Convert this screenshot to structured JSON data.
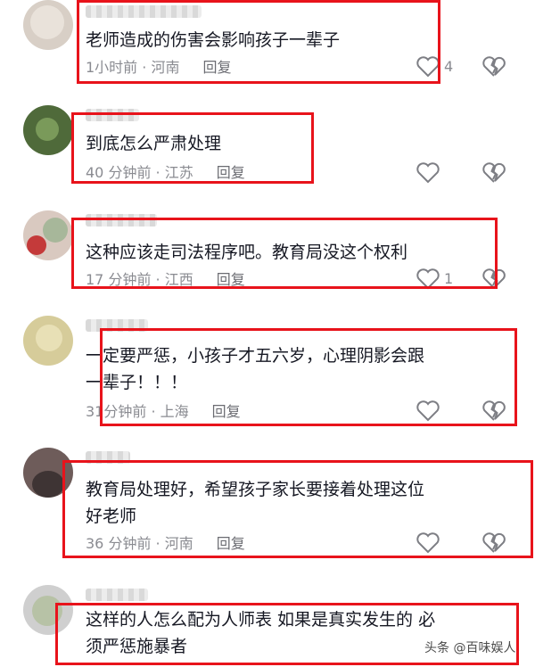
{
  "comments": [
    {
      "text": "老师造成的伤害会影响孩子一辈子",
      "time": "1小时前",
      "location": "河南",
      "reply": "回复",
      "likes": "4"
    },
    {
      "text": "到底怎么严肃处理",
      "time": "40 分钟前",
      "location": "江苏",
      "reply": "回复",
      "likes": ""
    },
    {
      "text": "这种应该走司法程序吧。教育局没这个权利",
      "time": "17 分钟前",
      "location": "江西",
      "reply": "回复",
      "likes": "1"
    },
    {
      "text": "一定要严惩，小孩子才五六岁，心理阴影会跟\n一辈子！！！",
      "time": "31分钟前",
      "location": "上海",
      "reply": "回复",
      "likes": ""
    },
    {
      "text": "教育局处理好，希望孩子家长要接着处理这位\n好老师",
      "time": "36 分钟前",
      "location": "河南",
      "reply": "回复",
      "likes": ""
    },
    {
      "text": "这样的人怎么配为人师表 如果是真实发生的 必\n须严惩施暴者",
      "time": "",
      "location": "",
      "reply": "",
      "likes": ""
    }
  ],
  "separator": " · ",
  "watermark": "头条 @百味娱人",
  "colors": {
    "highlight_box": "#e8131b",
    "meta_text": "#8a8b91",
    "body_text": "#161823"
  },
  "icons": {
    "like": "heart-outline-icon",
    "dislike": "broken-heart-outline-icon"
  }
}
